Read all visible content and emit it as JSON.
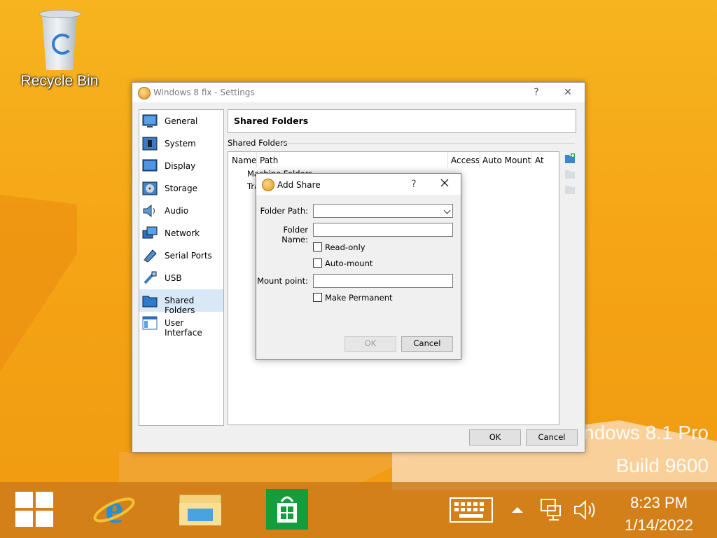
{
  "desktop": {
    "recycle_bin_label": "Recycle Bin",
    "watermark_line1": "ndows 8.1 Pro",
    "watermark_line2": "Build 9600"
  },
  "settings_window": {
    "title": "Windows 8 fix - Settings",
    "help_glyph": "?",
    "close_glyph": "✕",
    "sidebar": [
      {
        "label": "General",
        "icon": "general-icon"
      },
      {
        "label": "System",
        "icon": "system-icon"
      },
      {
        "label": "Display",
        "icon": "display-icon"
      },
      {
        "label": "Storage",
        "icon": "storage-icon"
      },
      {
        "label": "Audio",
        "icon": "audio-icon"
      },
      {
        "label": "Network",
        "icon": "network-icon"
      },
      {
        "label": "Serial Ports",
        "icon": "serial-ports-icon"
      },
      {
        "label": "USB",
        "icon": "usb-icon"
      },
      {
        "label": "Shared Folders",
        "icon": "shared-folders-icon",
        "active": true
      },
      {
        "label": "User Interface",
        "icon": "user-interface-icon"
      }
    ],
    "page_header": "Shared Folders",
    "group_label": "Shared Folders",
    "table": {
      "columns": [
        "Name",
        "Path",
        "Access",
        "Auto Mount",
        "At"
      ],
      "items": [
        "Machine Folders",
        "Tra"
      ]
    },
    "ok_label": "OK",
    "cancel_label": "Cancel"
  },
  "add_share_dialog": {
    "title": "Add Share",
    "help_glyph": "?",
    "folder_path_label": "Folder Path:",
    "folder_path_value": "",
    "folder_name_label": "Folder Name:",
    "folder_name_value": "",
    "read_only_label": "Read-only",
    "read_only_checked": false,
    "auto_mount_label": "Auto-mount",
    "auto_mount_checked": false,
    "mount_point_label": "Mount point:",
    "mount_point_value": "",
    "make_permanent_label": "Make Permanent",
    "make_permanent_checked": false,
    "ok_label": "OK",
    "ok_enabled": false,
    "cancel_label": "Cancel"
  },
  "taskbar": {
    "time": "8:23 PM",
    "date": "1/14/2022",
    "pinned": [
      "start-icon",
      "internet-explorer-icon",
      "file-explorer-icon",
      "store-icon"
    ],
    "tray": [
      "keyboard-icon",
      "show-hidden-icons-icon",
      "network-icon",
      "volume-icon"
    ]
  },
  "colors": {
    "desktop_bg": "#f5a516",
    "taskbar": "#cc7a1c",
    "store_green": "#139d3c",
    "ie_blue": "#1f8fe0"
  }
}
